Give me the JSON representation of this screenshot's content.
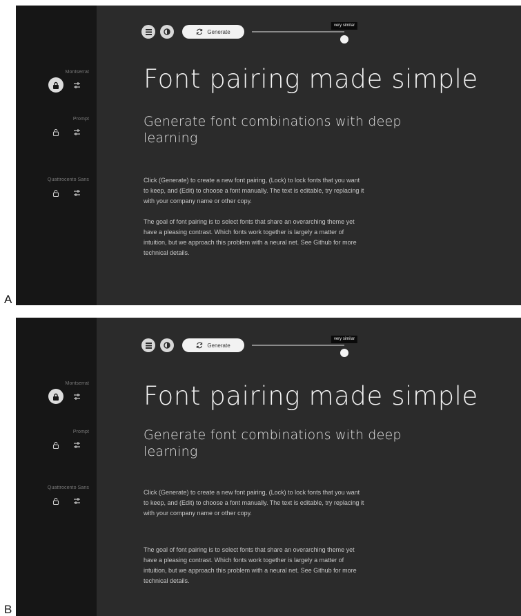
{
  "panels": [
    {
      "label": "A",
      "sidebar": {
        "fonts": [
          {
            "name": "Montserrat",
            "locked": true
          },
          {
            "name": "Prompt",
            "locked": false
          },
          {
            "name": "Quattrocento Sans",
            "locked": false
          }
        ]
      },
      "toolbar": {
        "list_icon": "list-icon",
        "contrast_icon": "contrast-icon",
        "generate_label": "Generate",
        "slider_tooltip": "very similar",
        "slider_value": 1.0
      },
      "headline": "Font pairing made simple",
      "subhead": "Generate font combinations with deep learning",
      "paragraphs": [
        "Click (Generate) to create a new font pairing, (Lock) to lock fonts that you want to keep, and (Edit) to choose a font manually. The text is editable, try replacing it with your company name or other copy.",
        "The goal of font pairing is to select fonts that share an overarching theme yet have a pleasing contrast. Which fonts work together is largely a matter of intuition, but we approach this problem with a neural net. See Github for more technical details."
      ]
    },
    {
      "label": "B",
      "sidebar": {
        "fonts": [
          {
            "name": "Montserrat",
            "locked": true
          },
          {
            "name": "Prompt",
            "locked": false
          },
          {
            "name": "Quattrocento Sans",
            "locked": false
          }
        ]
      },
      "toolbar": {
        "list_icon": "list-icon",
        "contrast_icon": "contrast-icon",
        "generate_label": "Generate",
        "slider_tooltip": "very similar",
        "slider_value": 1.0
      },
      "headline": "Font pairing made simple",
      "subhead": "Generate font combinations with deep learning",
      "paragraphs": [
        "Click (Generate) to create a new font pairing, (Lock) to lock fonts that you want to keep, and (Edit) to choose a font manually. The text is editable, try replacing it with your company name or other copy.",
        "The goal of font pairing is to select fonts that share an overarching theme yet have a pleasing contrast. Which fonts work together is largely a matter of intuition, but we approach this problem with a neural net. See Github for more technical details."
      ]
    }
  ],
  "colors": {
    "background": "#2b2b2b",
    "sidebar": "#161616",
    "headline": "#f5f5f5",
    "body_text": "#c8c8c8"
  }
}
